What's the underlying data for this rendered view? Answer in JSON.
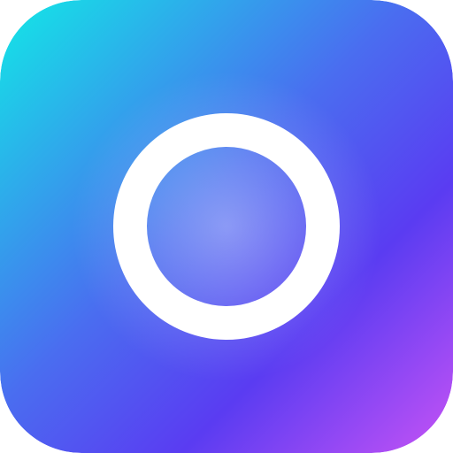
{
  "icon": {
    "name": "ring-icon",
    "background_gradient": {
      "start": "#12E8E6",
      "mid": "#4A6DF0",
      "deep": "#5A3CF2",
      "end": "#C653F5"
    },
    "ring_color": "#FFFFFF",
    "glow_color": "#FFFFFF"
  }
}
